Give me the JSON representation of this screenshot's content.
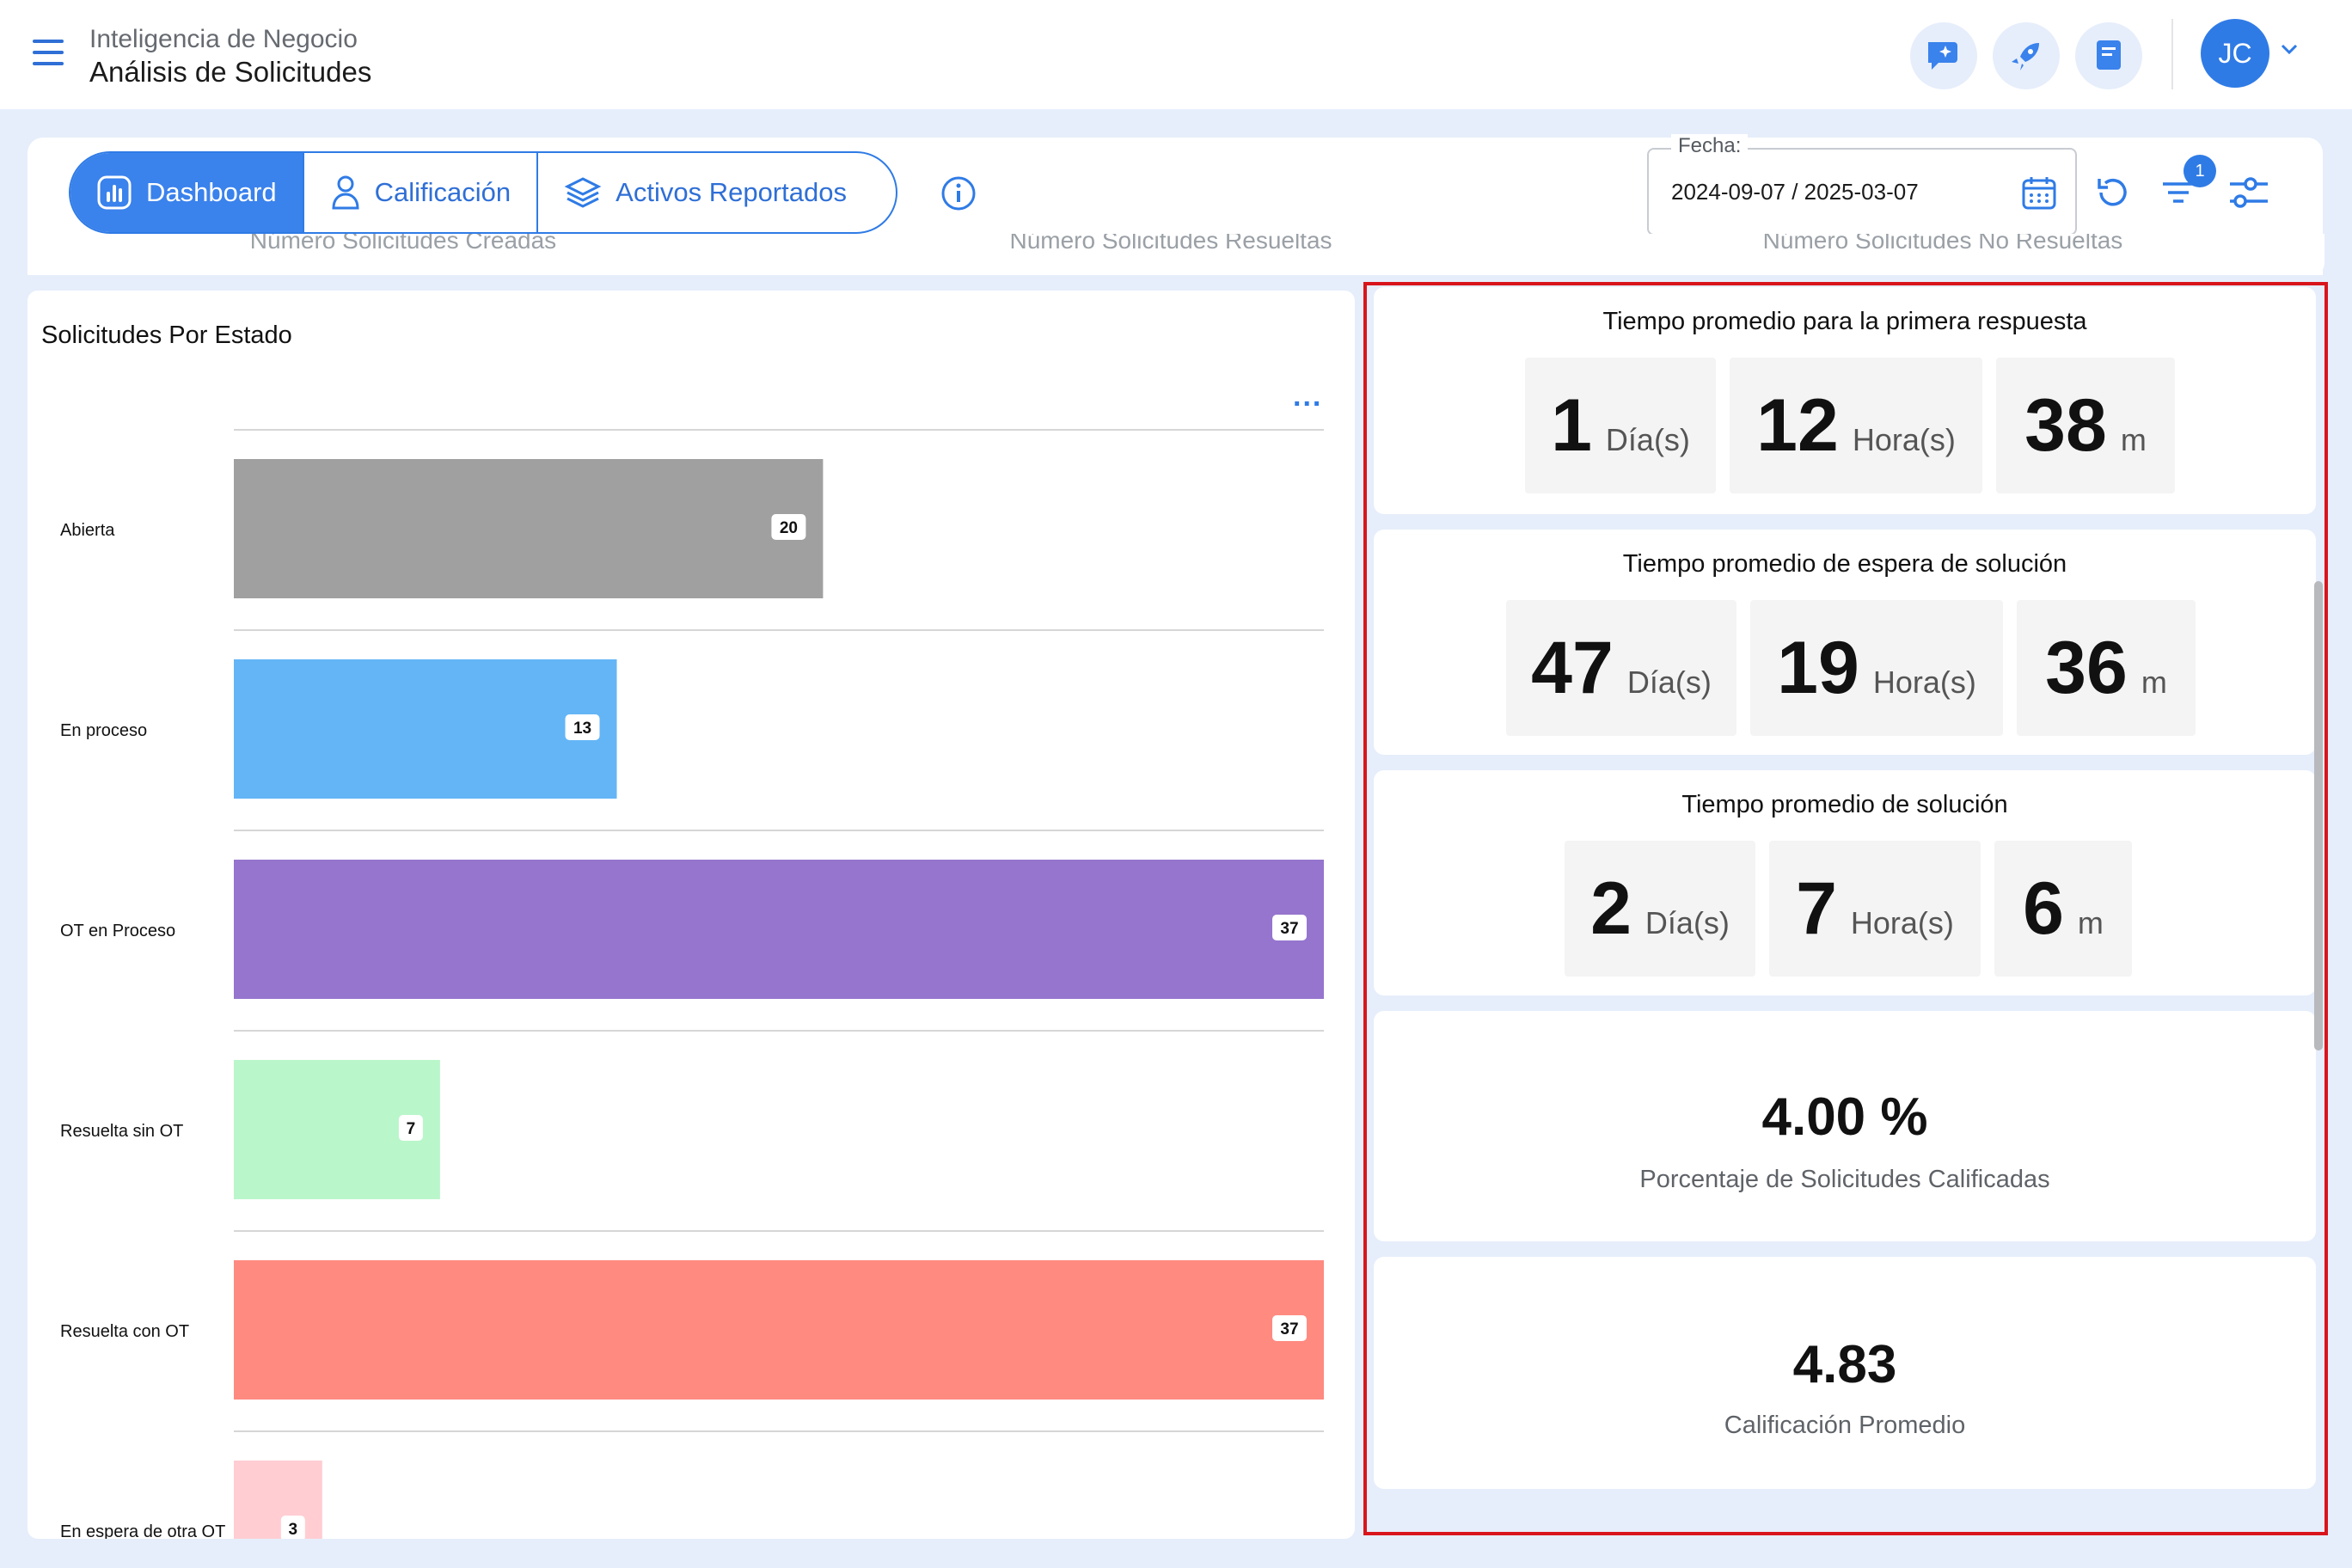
{
  "header": {
    "subtitle": "Inteligencia de Negocio",
    "title": "Análisis de Solicitudes",
    "avatar_initials": "JC"
  },
  "tabs": [
    {
      "label": "Dashboard",
      "icon": "chart-bar-icon",
      "active": true
    },
    {
      "label": "Calificación",
      "icon": "user-icon",
      "active": false
    },
    {
      "label": "Activos Reportados",
      "icon": "layers-icon",
      "active": false
    }
  ],
  "date_filter": {
    "label": "Fecha:",
    "value": "2024-09-07 / 2025-03-07"
  },
  "filter_badge": "1",
  "kpi_cards_partial": [
    "Número Solicitudes Creadas",
    "Número Solicitudes Resueltas",
    "Número Solicitudes No Resueltas"
  ],
  "chart": {
    "title": "Solicitudes Por Estado",
    "menu_label": "...",
    "colors": [
      "#a0a0a0",
      "#64b5f6",
      "#9575cd",
      "#b9f6ca",
      "#ff8a80",
      "#ffcdd2"
    ]
  },
  "chart_data": {
    "type": "bar",
    "orientation": "horizontal",
    "title": "Solicitudes Por Estado",
    "categories": [
      "Abierta",
      "En proceso",
      "OT en Proceso",
      "Resuelta sin OT",
      "Resuelta con OT",
      "En espera de otra OT"
    ],
    "values": [
      20,
      13,
      37,
      7,
      37,
      3
    ],
    "xlim": [
      0,
      37
    ]
  },
  "metrics": {
    "first_response": {
      "title": "Tiempo promedio para la primera respuesta",
      "days": "1",
      "days_unit": "Día(s)",
      "hours": "12",
      "hours_unit": "Hora(s)",
      "minutes": "38",
      "minutes_unit": "m"
    },
    "wait_solution": {
      "title": "Tiempo promedio de espera de solución",
      "days": "47",
      "days_unit": "Día(s)",
      "hours": "19",
      "hours_unit": "Hora(s)",
      "minutes": "36",
      "minutes_unit": "m"
    },
    "solution": {
      "title": "Tiempo promedio de solución",
      "days": "2",
      "days_unit": "Día(s)",
      "hours": "7",
      "hours_unit": "Hora(s)",
      "minutes": "6",
      "minutes_unit": "m"
    },
    "percent_rated": {
      "value": "4.00 %",
      "label": "Porcentaje de Solicitudes Calificadas"
    },
    "avg_rating": {
      "value": "4.83",
      "label": "Calificación Promedio"
    }
  }
}
